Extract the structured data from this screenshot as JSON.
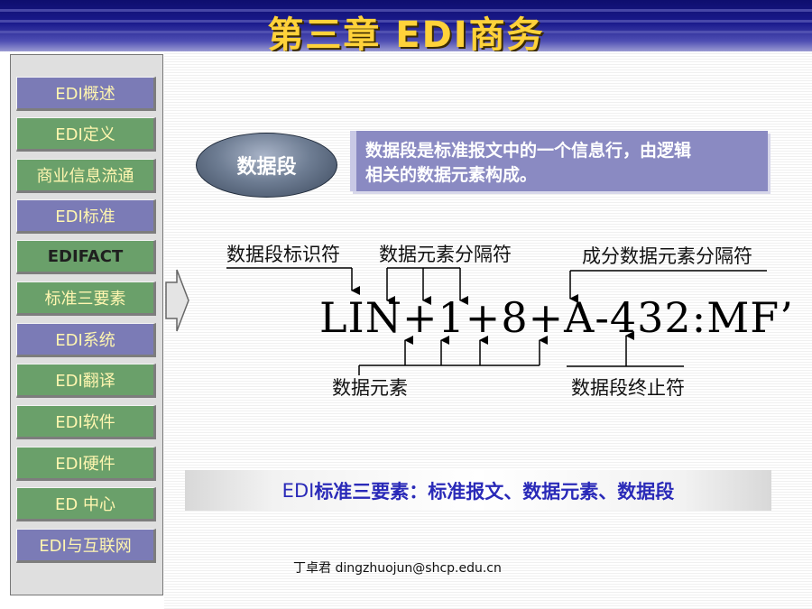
{
  "header": {
    "title": "第三章 EDI商务"
  },
  "sidebar": {
    "items": [
      {
        "label": "EDI概述"
      },
      {
        "label": "EDI定义"
      },
      {
        "label": "商业信息流通"
      },
      {
        "label": "EDI标准"
      },
      {
        "label": "EDIFACT"
      },
      {
        "label": "标准三要素"
      },
      {
        "label": "EDI系统"
      },
      {
        "label": "EDI翻译"
      },
      {
        "label": "EDI软件"
      },
      {
        "label": "EDI硬件"
      },
      {
        "label": "ED  中心"
      },
      {
        "label": "EDI与互联网"
      }
    ],
    "active_index": 4
  },
  "content": {
    "term": "数据段",
    "definition_line1": "数据段是标准报文中的一个信息行，由逻辑",
    "definition_line2": "相关的数据元素构成。",
    "diagram": {
      "label_segment_tag": "数据段标识符",
      "label_element_sep": "数据元素分隔符",
      "label_component_sep": "成分数据元素分隔符",
      "segment_text": "LIN+1+8+A-432:MF’",
      "label_element": "数据元素",
      "label_terminator": "数据段终止符"
    },
    "summary": {
      "prefix": "EDI",
      "text": "标准三要素：标准报文、数据元素、数据段"
    }
  },
  "footer": {
    "author": "丁卓君 dingzhuojun@shcp.edu.cn"
  },
  "colors": {
    "title": "#ffd23a",
    "header": "#1a1a8c",
    "nav_purple": "#7b7bb6",
    "nav_green": "#6aa06a",
    "definition_box": "#8a8ac2",
    "summary_text": "#2a2ab8"
  }
}
